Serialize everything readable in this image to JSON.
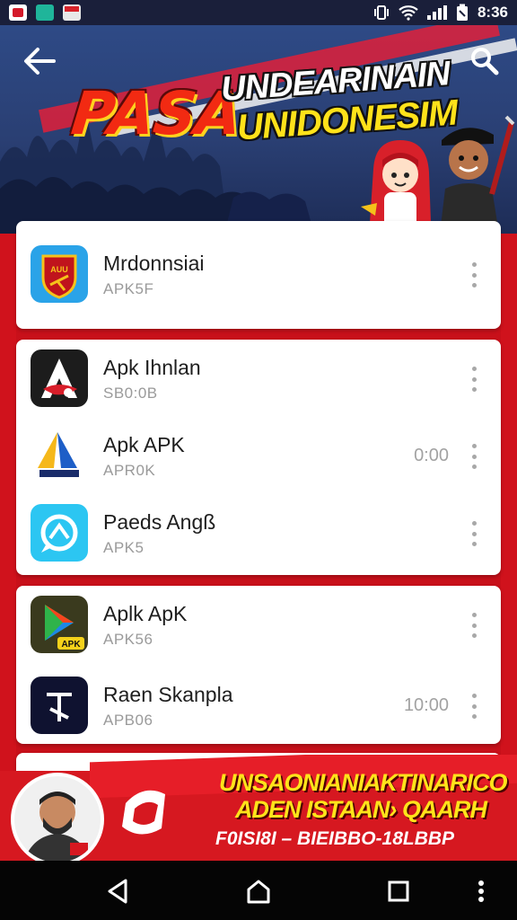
{
  "status_bar": {
    "time": "8:36",
    "icons": [
      "notification-red-icon",
      "notification-teal-icon",
      "flag-icon",
      "vibrate-icon",
      "wifi-icon",
      "signal-icon",
      "battery-icon"
    ]
  },
  "header": {
    "back_icon": "arrow-left-icon",
    "search_icon": "search-icon",
    "banner_title_main": "PASA",
    "banner_title_line1": "UNDEARINAIN",
    "banner_title_line2": "UNIDONESIM"
  },
  "cards": [
    {
      "items": [
        {
          "name": "Mrdonnsiai",
          "sub": "APK5F",
          "time": "",
          "icon": "shield-app-icon"
        }
      ]
    },
    {
      "items": [
        {
          "name": "Apk Ihnlan",
          "sub": "SB0:0B",
          "time": "",
          "icon": "a-logo-app-icon"
        },
        {
          "name": "Apk APK",
          "sub": "APR0K",
          "time": "0:00",
          "icon": "triangle-app-icon"
        },
        {
          "name": "Paeds Angß",
          "sub": "APK5",
          "time": "",
          "icon": "chat-app-icon"
        }
      ]
    },
    {
      "items": [
        {
          "name": "Aplk ApK",
          "sub": "APK56",
          "time": "",
          "icon": "play-store-app-icon"
        },
        {
          "name": "Raen Skanpla",
          "sub": "APB06",
          "time": "10:00",
          "icon": "dark-app-icon"
        }
      ]
    }
  ],
  "promo": {
    "line1": "UNSAONIANIAKTINARICO",
    "line2": "ADEN ISTAAN› QAARH",
    "line3": "F0ISI8I – BIEIBBO-18LBBP"
  },
  "nav": {
    "back": "nav-back-icon",
    "home": "nav-home-icon",
    "recents": "nav-recents-icon",
    "more": "nav-more-icon"
  },
  "colors": {
    "brand_red": "#d0121c",
    "banner_blue": "#2e4a86",
    "promo_yellow": "#ffe31a"
  }
}
